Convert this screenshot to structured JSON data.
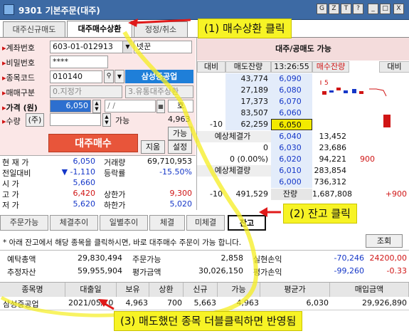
{
  "window": {
    "title": "9301 기본주문(대주)",
    "ctrl_buttons": [
      "G",
      "Z",
      "T",
      "?",
      "_",
      "□",
      "X"
    ]
  },
  "tabs": [
    "대주신규매도",
    "대주매수상환",
    "정정/취소"
  ],
  "order": {
    "account_label": "계좌번호",
    "account": "603-01-012913",
    "account_name": "넷꾼",
    "password_label": "비밀번호",
    "password": "****",
    "code_label": "종목코드",
    "code": "010140",
    "stock_name": "삼성중공업",
    "trade_type_label": "매매구분",
    "trade_type": "0.지정가",
    "credit_type": "3.유통대주상환",
    "price_label": "가격 (원)",
    "price": "6,050",
    "price_unit": "호",
    "qty_label": "수량",
    "qty_unit": "(주)",
    "avail_label": "가능",
    "avail_qty": "4,963",
    "avail_btn": "가능",
    "buy_btn": "대주매수",
    "jigeum_btn": "지움",
    "setting_btn": "설정"
  },
  "quote": {
    "rows": [
      {
        "l": "현 재 가",
        "v": "6,050",
        "l2": "거래량",
        "v2": "69,710,953"
      },
      {
        "l": "전일대비",
        "v": "▼ -1,110",
        "l2": "등락률",
        "v2": "-15.50%"
      },
      {
        "l": "시 가",
        "v": "5,660",
        "l2": "",
        "v2": ""
      },
      {
        "l": "고 가",
        "v": "6,420",
        "l2": "상한가",
        "v2": "9,300"
      },
      {
        "l": "저 가",
        "v": "5,620",
        "l2": "하한가",
        "v2": "5,020"
      }
    ]
  },
  "hoga": {
    "title": "대주/공매도 가능",
    "cols": [
      "대비",
      "매도잔량",
      "13:26:55",
      "매수잔량",
      "대비"
    ],
    "ask": [
      [
        "",
        "43,774",
        "6,090"
      ],
      [
        "",
        "27,189",
        "6,080"
      ],
      [
        "",
        "17,373",
        "6,070"
      ],
      [
        "",
        "83,507",
        "6,060"
      ],
      [
        "-10",
        "62,259",
        "6,050"
      ]
    ],
    "exp_label": "예상체결가",
    "exp_price": "6,040",
    "exp_val": "0",
    "exp_pct": "0 (0.00%)",
    "exp_qty_label": "예상체결량",
    "bid": [
      [
        "6,040",
        "13,452",
        ""
      ],
      [
        "6,030",
        "23,686",
        ""
      ],
      [
        "6,020",
        "94,221",
        "900"
      ],
      [
        "6,010",
        "283,854",
        ""
      ],
      [
        "6,000",
        "736,312",
        ""
      ]
    ],
    "total": {
      "l": "-10",
      "ask": "491,529",
      "label": "잔량",
      "bid": "1,687,808",
      "r": "+900"
    }
  },
  "bottom_tabs": [
    "주문가능",
    "체결추이",
    "일별추이",
    "체결",
    "미체결",
    "잔고"
  ],
  "summary": {
    "notice": "* 아래 잔고에서 해당 종목을 클릭하시면, 바로 대주매수 주문이 가능 합니다.",
    "query_btn": "조회",
    "l1": [
      "예탁총액",
      "29,830,494",
      "주문가능",
      "2,858",
      "실현손익",
      "-70,246",
      "24200,00"
    ],
    "l2": [
      "추정자산",
      "59,955,904",
      "평가금액",
      "30,026,150",
      "평가손익",
      "-99,260",
      "-0.33"
    ]
  },
  "table": {
    "headers": [
      "종목명",
      "대출일",
      "보유",
      "상환",
      "신규",
      "가능",
      "평균가",
      "매입금액"
    ],
    "row": [
      "삼성중공업",
      "2021/05/10",
      "4,963",
      "700",
      "5,663",
      "4,963",
      "6,030",
      "29,926,890"
    ]
  },
  "annotations": {
    "a1": "(1) 매수상환 클릭",
    "a2": "(2) 잔고 클릭",
    "a3": "(3) 매도했던 종목 더블클릭하면 반영됨"
  },
  "colors": {
    "accent": "#3d6aa4",
    "order_bg": "#fbe7e7",
    "annotation": "#f7f325",
    "buy": "#e8553a"
  }
}
